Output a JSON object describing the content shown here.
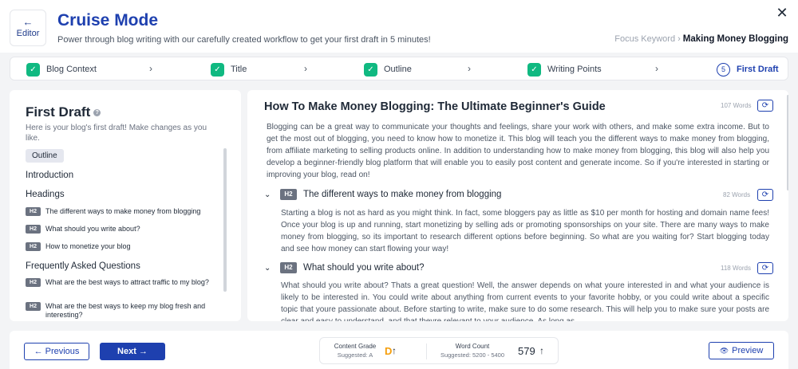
{
  "header": {
    "editor_arrow": "←",
    "editor_label": "Editor",
    "title": "Cruise Mode",
    "subtitle": "Power through blog writing with our carefully created workflow to get your first draft in 5 minutes!",
    "focus_keyword_label": "Focus Keyword",
    "focus_keyword_sep": "›",
    "focus_keyword_value": "Making Money Blogging",
    "close_glyph": "✕"
  },
  "stepper": {
    "steps": [
      {
        "label": "Blog Context",
        "status": "done",
        "check": "✓"
      },
      {
        "label": "Title",
        "status": "done",
        "check": "✓"
      },
      {
        "label": "Outline",
        "status": "done",
        "check": "✓"
      },
      {
        "label": "Writing Points",
        "status": "done",
        "check": "✓"
      },
      {
        "label": "First Draft",
        "status": "active",
        "number": "5"
      }
    ],
    "chevron": "›"
  },
  "left_panel": {
    "title": "First Draft",
    "info_glyph": "?",
    "description": "Here is your blog's first draft! Make changes as you like.",
    "outline_chip": "Outline",
    "introduction": "Introduction",
    "headings_label": "Headings",
    "headings": [
      {
        "tag": "H2",
        "text": "The different ways to make money from blogging"
      },
      {
        "tag": "H2",
        "text": "What should you write about?"
      },
      {
        "tag": "H2",
        "text": "How to monetize your blog"
      }
    ],
    "faq_label": "Frequently Asked Questions",
    "faqs": [
      {
        "tag": "H2",
        "text": "What are the best ways to attract traffic to my blog?"
      },
      {
        "tag": "H2",
        "text": "What are the best ways to keep my blog fresh and interesting?"
      }
    ]
  },
  "draft": {
    "title": "How To Make Money Blogging: The Ultimate Beginner's Guide",
    "title_words": "107 Words",
    "refresh_glyph": "⟳",
    "intro": "Blogging can be a great way to communicate your thoughts and feelings, share your work with others, and make some extra income. But to get the most out of blogging, you need to know how to monetize it. This blog will teach you the different ways to make money from blogging, from affiliate marketing to selling products online. In addition to understanding how to make money from blogging, this blog will also help you develop a beginner-friendly blog platform that will enable you to easily post content and generate income. So if you're interested in starting or improving your blog, read on!",
    "chevron_glyph": "⌄",
    "sections": [
      {
        "tag": "H2",
        "heading": "The different ways to make money from blogging",
        "words": "82 Words",
        "body": "Starting a blog is not as hard as you might think. In fact, some bloggers pay as little as $10 per month for hosting and domain name fees! Once your blog is up and running, start monetizing by selling ads or promoting sponsorships on your site. There are many ways to make money from blogging, so its important to research different options before beginning. So what are you waiting for? Start blogging today and see how money can start flowing your way!"
      },
      {
        "tag": "H2",
        "heading": "What should you write about?",
        "words": "118 Words",
        "body": "What should you write about? Thats a great question! Well, the answer depends on what youre interested in and what your audience is likely to be interested in. You could write about anything from current events to your favorite hobby, or you could write about a specific topic that youre passionate about. Before starting to write, make sure to do some research. This will help you to make sure your posts are clear and easy to understand, and that theyre relevant to your audience. As long as"
      }
    ]
  },
  "footer": {
    "prev_label": "← Previous",
    "next_label": "Next →",
    "preview_label": "Preview",
    "preview_icon": "👁",
    "grade_label": "Content Grade",
    "grade_suggested": "Suggested: A",
    "grade_value": "D",
    "up_arrow": "↑",
    "count_label": "Word Count",
    "count_suggested": "Suggested: 5200 - 5400",
    "count_value": "579"
  },
  "colors": {
    "accent": "#1e40af",
    "success": "#10b981",
    "grade": "#f59e0b"
  }
}
